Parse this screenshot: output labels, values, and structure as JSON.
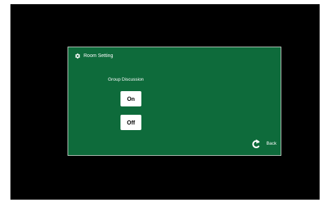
{
  "dialog": {
    "title": "Room Setting",
    "title_icon": "gear-icon",
    "background_color": "#0e6b3b"
  },
  "group_discussion": {
    "label": "Group Discussion",
    "on_label": "On",
    "off_label": "Off"
  },
  "navigation": {
    "back_label": "Back",
    "back_icon": "back-arrow-icon"
  }
}
